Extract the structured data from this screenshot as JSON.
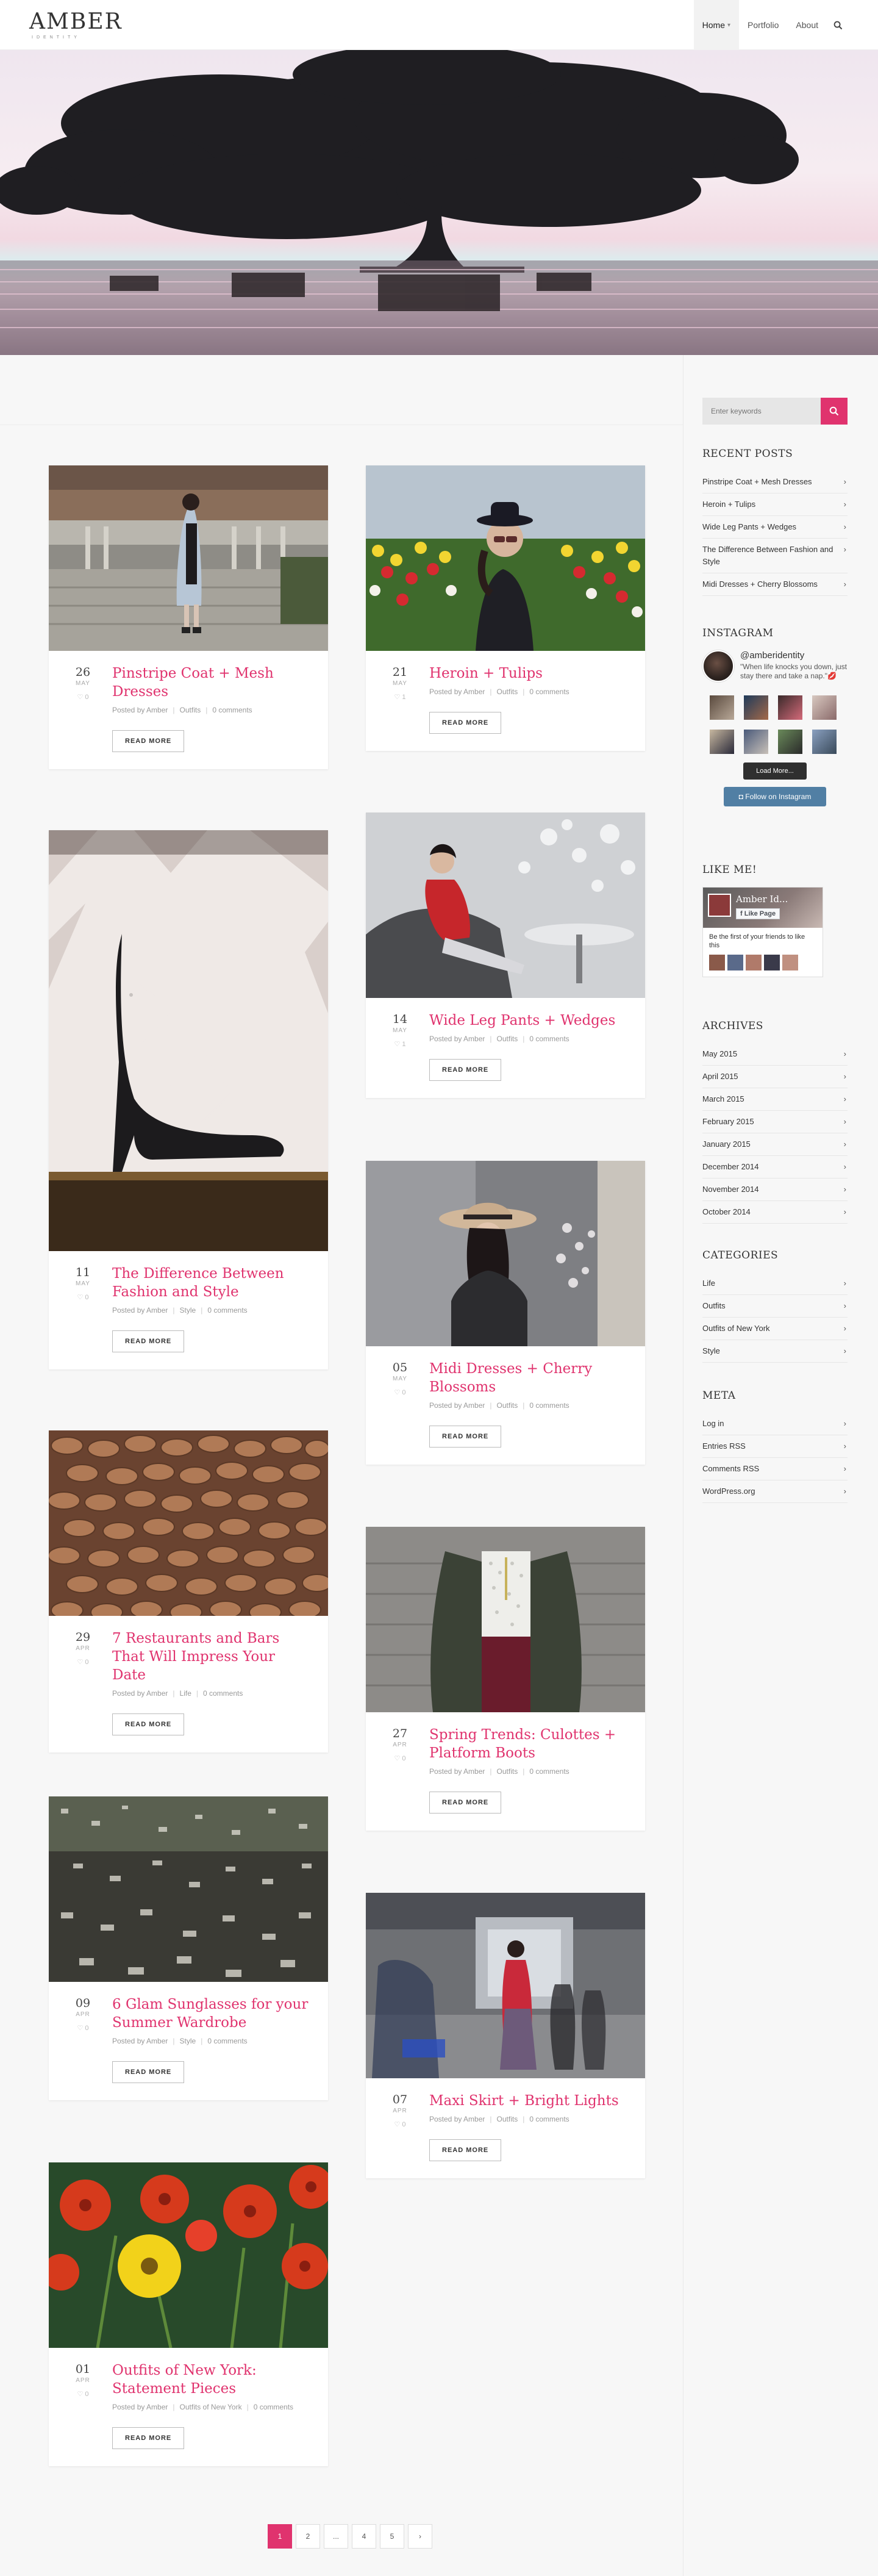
{
  "header": {
    "logo": "AMBER",
    "tagline": "IDENTITY",
    "nav": [
      {
        "label": "Home"
      },
      {
        "label": "Portfolio"
      },
      {
        "label": "About"
      }
    ]
  },
  "posts": [
    {
      "day": "26",
      "month": "MAY",
      "likes": "0",
      "title": "Pinstripe Coat + Mesh Dresses",
      "author_prefix": "Posted by Amber",
      "category": "Outfits",
      "comments": "0 comments",
      "read_more": "READ MORE"
    },
    {
      "day": "21",
      "month": "MAY",
      "likes": "1",
      "title": "Heroin + Tulips",
      "author_prefix": "Posted by Amber",
      "category": "Outfits",
      "comments": "0 comments",
      "read_more": "READ MORE"
    },
    {
      "day": "14",
      "month": "MAY",
      "likes": "1",
      "title": "Wide Leg Pants + Wedges",
      "author_prefix": "Posted by Amber",
      "category": "Outfits",
      "comments": "0 comments",
      "read_more": "READ MORE"
    },
    {
      "day": "11",
      "month": "MAY",
      "likes": "0",
      "title": "The Difference Between Fashion and Style",
      "author_prefix": "Posted by Amber",
      "category": "Style",
      "comments": "0 comments",
      "read_more": "READ MORE"
    },
    {
      "day": "05",
      "month": "MAY",
      "likes": "0",
      "title": "Midi Dresses + Cherry Blossoms",
      "author_prefix": "Posted by Amber",
      "category": "Outfits",
      "comments": "0 comments",
      "read_more": "READ MORE"
    },
    {
      "day": "29",
      "month": "APR",
      "likes": "0",
      "title": "7 Restaurants and Bars That Will Impress Your Date",
      "author_prefix": "Posted by Amber",
      "category": "Life",
      "comments": "0 comments",
      "read_more": "READ MORE"
    },
    {
      "day": "27",
      "month": "APR",
      "likes": "0",
      "title": "Spring Trends: Culottes + Platform Boots",
      "author_prefix": "Posted by Amber",
      "category": "Outfits",
      "comments": "0 comments",
      "read_more": "READ MORE"
    },
    {
      "day": "09",
      "month": "APR",
      "likes": "0",
      "title": "6 Glam Sunglasses for your Summer Wardrobe",
      "author_prefix": "Posted by Amber",
      "category": "Style",
      "comments": "0 comments",
      "read_more": "READ MORE"
    },
    {
      "day": "07",
      "month": "APR",
      "likes": "0",
      "title": "Maxi Skirt + Bright Lights",
      "author_prefix": "Posted by Amber",
      "category": "Outfits",
      "comments": "0 comments",
      "read_more": "READ MORE"
    },
    {
      "day": "01",
      "month": "APR",
      "likes": "0",
      "title": "Outfits of New York: Statement Pieces",
      "author_prefix": "Posted by Amber",
      "category": "Outfits of New York",
      "comments": "0 comments",
      "read_more": "READ MORE"
    }
  ],
  "sidebar": {
    "search_placeholder": "Enter keywords",
    "recent_title": "RECENT POSTS",
    "recent": [
      "Pinstripe Coat + Mesh Dresses",
      "Heroin + Tulips",
      "Wide Leg Pants + Wedges",
      "The Difference Between Fashion and Style",
      "Midi Dresses + Cherry Blossoms"
    ],
    "instagram_title": "INSTAGRAM",
    "ig_user": "@amberidentity",
    "ig_bio": "\"When life knocks you down, just stay there and take a nap.\"💋",
    "ig_load": "Load More...",
    "ig_follow": "Follow on Instagram",
    "like_title": "LIKE ME!",
    "fb_name": "Amber Id...",
    "fb_like": "Like Page",
    "fb_text": "Be the first of your friends to like this",
    "archives_title": "ARCHIVES",
    "archives": [
      "May 2015",
      "April 2015",
      "March 2015",
      "February 2015",
      "January 2015",
      "December 2014",
      "November 2014",
      "October 2014"
    ],
    "categories_title": "CATEGORIES",
    "categories": [
      "Life",
      "Outfits",
      "Outfits of New York",
      "Style"
    ],
    "meta_title": "META",
    "meta": [
      "Log in",
      "Entries RSS",
      "Comments RSS",
      "WordPress.org"
    ]
  },
  "pagination": [
    "1",
    "2",
    "...",
    "4",
    "5",
    "›"
  ]
}
